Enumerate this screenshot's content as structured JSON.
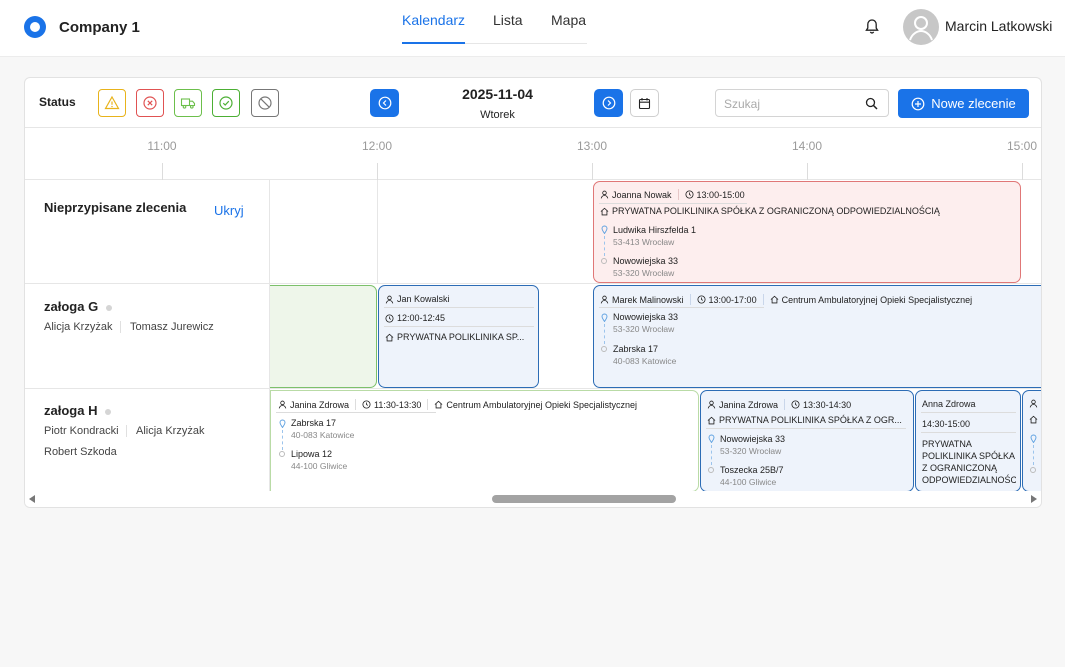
{
  "header": {
    "company": "Company 1",
    "tabs": [
      {
        "label": "Kalendarz",
        "active": true
      },
      {
        "label": "Lista",
        "active": false
      },
      {
        "label": "Mapa",
        "active": false
      }
    ],
    "user_name": "Marcin Latkowski",
    "icons": {
      "bell": "bell-icon",
      "avatar": "user-avatar-icon"
    }
  },
  "toolbar": {
    "status_label": "Status",
    "status_filters": [
      {
        "name": "warning",
        "icon": "warning-triangle-icon",
        "color": "#e8b31b"
      },
      {
        "name": "cancelled",
        "icon": "x-circle-icon",
        "color": "#e05252"
      },
      {
        "name": "in-transit",
        "icon": "truck-icon",
        "color": "#6cbf4b"
      },
      {
        "name": "done",
        "icon": "check-circle-icon",
        "color": "#4caf34"
      },
      {
        "name": "blocked",
        "icon": "ban-icon",
        "color": "#777777"
      }
    ],
    "date": "2025-11-04",
    "weekday": "Wtorek",
    "search_placeholder": "Szukaj",
    "new_order_label": "Nowe zlecenie",
    "accent": "#1a73e8"
  },
  "timeline": {
    "hours": [
      "11:00",
      "12:00",
      "13:00",
      "14:00",
      "15:00"
    ]
  },
  "rows": {
    "unassigned": {
      "title": "Nieprzypisane zlecenia",
      "hide_label": "Ukryj"
    },
    "crew_g": {
      "title": "załoga G",
      "members": [
        "Alicja Krzyżak",
        "Tomasz Jurewicz"
      ]
    },
    "crew_h": {
      "title": "załoga H",
      "members": [
        "Piotr Kondracki",
        "Alicja Krzyżak",
        "Robert Szkoda"
      ]
    }
  },
  "events": {
    "unassigned_1": {
      "person": "Joanna Nowak",
      "time": "13:00-15:00",
      "client": "PRYWATNA POLIKLINIKA SPÓŁKA Z OGRANICZONĄ ODPOWIEDZIALNOŚCIĄ",
      "from_street": "Ludwika Hirszfelda 1",
      "from_city": "53-413 Wrocław",
      "to_street": "Nowowiejska 33",
      "to_city": "53-320 Wrocław",
      "status_color": "#e07777"
    },
    "g_1": {
      "person": "Jan Kowalski",
      "time": "12:00-12:45",
      "client": "PRYWATNA POLIKLINIKA SP..."
    },
    "g_2": {
      "person": "Marek Malinowski",
      "time": "13:00-17:00",
      "client": "Centrum Ambulatoryjnej Opieki Specjalistycznej",
      "from_street": "Nowowiejska 33",
      "from_city": "53-320 Wrocław",
      "to_street": "Zabrska 17",
      "to_city": "40-083 Katowice"
    },
    "h_1": {
      "person": "Janina Zdrowa",
      "time": "11:30-13:30",
      "client": "Centrum Ambulatoryjnej Opieki Specjalistycznej",
      "from_street": "Zabrska 17",
      "from_city": "40-083 Katowice",
      "to_street": "Lipowa 12",
      "to_city": "44-100 Gliwice"
    },
    "h_2": {
      "person": "Janina Zdrowa",
      "time": "13:30-14:30",
      "client": "PRYWATNA POLIKLINIKA SPÓŁKA Z OGR...",
      "from_street": "Nowowiejska 33",
      "from_city": "53-320 Wrocław",
      "to_street": "Toszecka 25B/7",
      "to_city": "44-100 Gliwice"
    },
    "h_3": {
      "person": "Anna Zdrowa",
      "time": "14:30-15:00",
      "client": "PRYWATNA POLIKLINIKA SPÓŁKA Z OGRANICZONĄ ODPOWIEDZIALNOŚC"
    }
  }
}
